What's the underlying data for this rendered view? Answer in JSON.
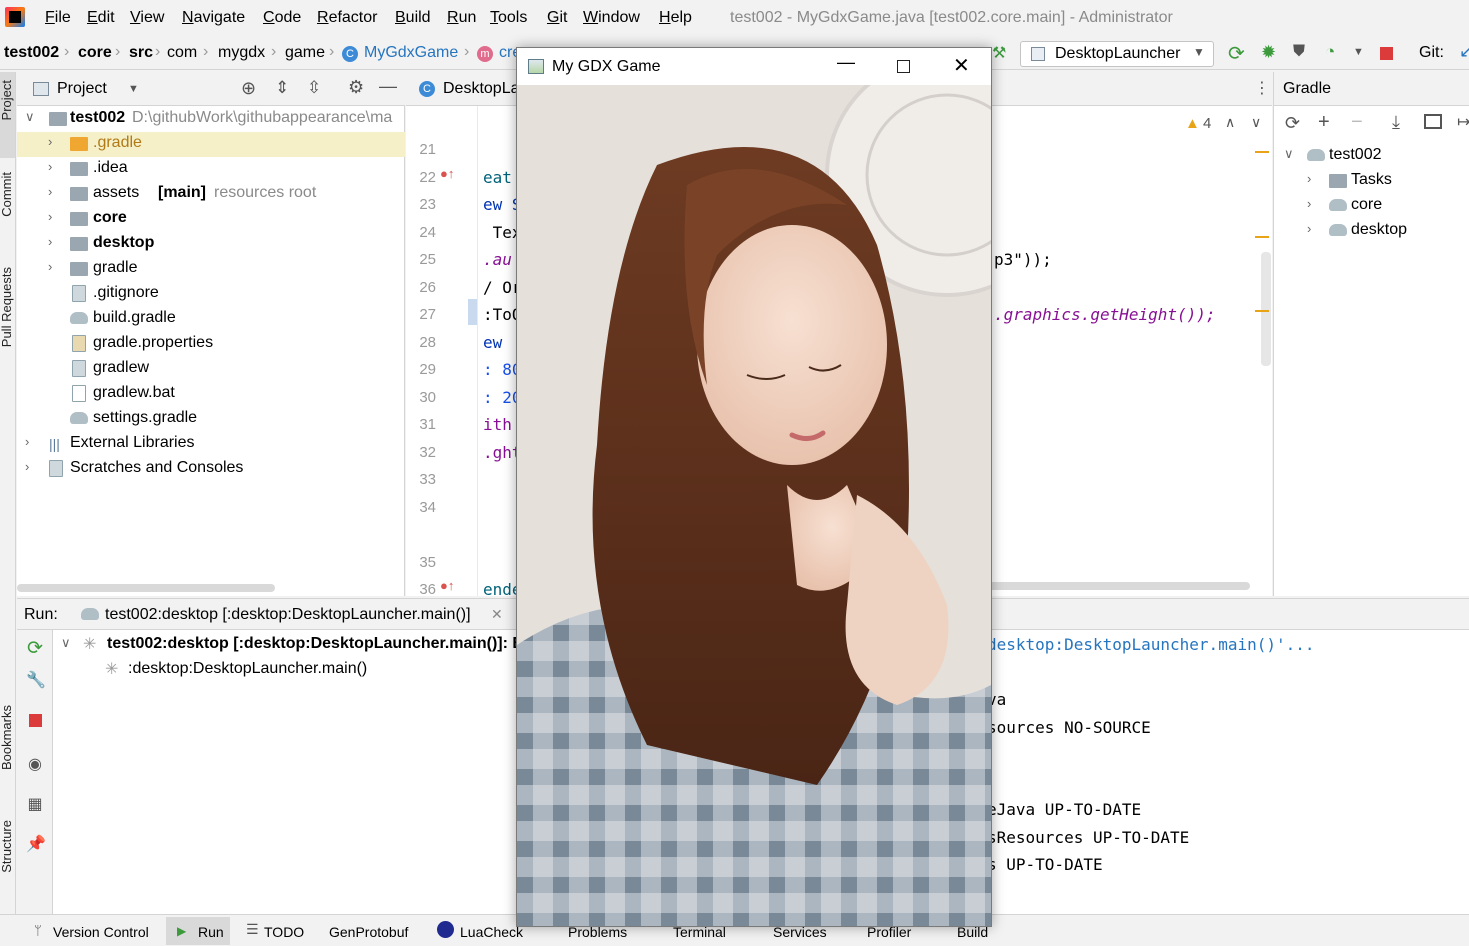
{
  "menu": {
    "items": [
      "File",
      "Edit",
      "View",
      "Navigate",
      "Code",
      "Refactor",
      "Build",
      "Run",
      "Tools",
      "Git",
      "Window",
      "Help"
    ],
    "title": "test002 - MyGdxGame.java [test002.core.main] - Administrator"
  },
  "breadcrumb": {
    "items": [
      "test002",
      "core",
      "src",
      "com",
      "mygdx",
      "game",
      "MyGdxGame",
      "cre"
    ],
    "run_config": "DesktopLauncher",
    "git_label": "Git:"
  },
  "left_strip": {
    "tabs": [
      "Project",
      "Commit",
      "Pull Requests",
      "Bookmarks",
      "Structure"
    ]
  },
  "project": {
    "header": "Project",
    "root": {
      "name": "test002",
      "path": "D:\\githubWork\\githubappearance\\ma"
    },
    "items": [
      {
        "name": ".gradle",
        "suffix": "",
        "note": ""
      },
      {
        "name": ".idea",
        "suffix": "",
        "note": ""
      },
      {
        "name": "assets",
        "suffix": "[main]",
        "note": "resources root"
      },
      {
        "name": "core",
        "suffix": "",
        "note": ""
      },
      {
        "name": "desktop",
        "suffix": "",
        "note": ""
      },
      {
        "name": "gradle",
        "suffix": "",
        "note": ""
      },
      {
        "name": ".gitignore",
        "suffix": "",
        "note": ""
      },
      {
        "name": "build.gradle",
        "suffix": "",
        "note": ""
      },
      {
        "name": "gradle.properties",
        "suffix": "",
        "note": ""
      },
      {
        "name": "gradlew",
        "suffix": "",
        "note": ""
      },
      {
        "name": "gradlew.bat",
        "suffix": "",
        "note": ""
      },
      {
        "name": "settings.gradle",
        "suffix": "",
        "note": ""
      },
      {
        "name": "External Libraries",
        "suffix": "",
        "note": ""
      },
      {
        "name": "Scratches and Consoles",
        "suffix": "",
        "note": ""
      }
    ]
  },
  "editor": {
    "tab": "DesktopLa",
    "warnings": "4",
    "line_numbers": [
      "21",
      "22",
      "23",
      "24",
      "25",
      "26",
      "27",
      "28",
      "29",
      "30",
      "31",
      "32",
      "33",
      "34",
      "35",
      "36"
    ],
    "code_fragments": [
      "eat",
      "ew S",
      " Tex",
      ".au",
      "/ Or",
      ":ToO",
      "ew ",
      ": 80",
      ": 20",
      "ith ",
      ".ght",
      "ende"
    ],
    "code_right": [
      "p3\"));",
      ".graphics.getHeight());"
    ]
  },
  "gradle": {
    "header": "Gradle",
    "root": "test002",
    "items": [
      "Tasks",
      "core",
      "desktop"
    ]
  },
  "run": {
    "label": "Run:",
    "tab": "test002:desktop [:desktop:DesktopLauncher.main()]",
    "tree_root": "test002:desktop [:desktop:DesktopLauncher.main()]: B",
    "tree_child": ":desktop:DesktopLauncher.main()",
    "console": [
      "desktop:DesktopLauncher.main()'...",
      "",
      "va",
      "sources NO-SOURCE",
      "",
      "",
      "eJava UP-TO-DATE",
      "sResources UP-TO-DATE",
      "s UP-TO-DATE"
    ]
  },
  "bottom_bar": {
    "tabs": [
      "Version Control",
      "Run",
      "TODO",
      "GenProtobuf",
      "LuaCheck",
      "Problems",
      "Terminal",
      "Services",
      "Profiler",
      "Build"
    ]
  },
  "game_window": {
    "title": "My GDX Game"
  },
  "colors": {
    "accent": "#2675bf",
    "selected_row": "#f5f0c8",
    "run_green": "#3c9a3c",
    "stop_red": "#db3b3b"
  }
}
